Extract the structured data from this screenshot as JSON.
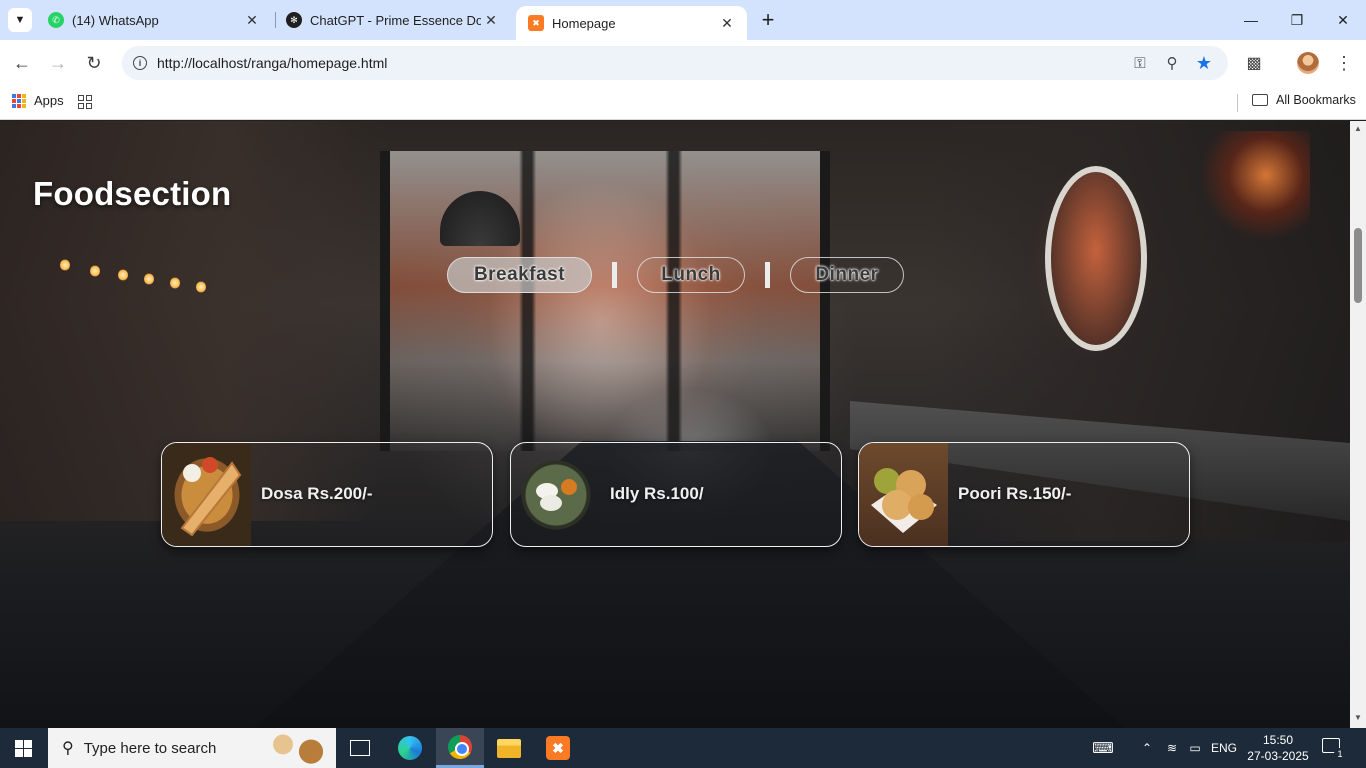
{
  "browser": {
    "tabs": [
      {
        "title": "(14) WhatsApp",
        "icon": "whatsapp-icon",
        "active": false
      },
      {
        "title": "ChatGPT - Prime Essence Doc",
        "icon": "chatgpt-icon",
        "active": false
      },
      {
        "title": "Homepage",
        "icon": "xampp-icon",
        "active": true
      }
    ],
    "url": "http://localhost/ranga/homepage.html",
    "bookmarks": {
      "apps_label": "Apps",
      "all_bookmarks_label": "All Bookmarks"
    }
  },
  "page": {
    "logo": "Foodsection",
    "menu": [
      {
        "label": "Breakfast",
        "active": true
      },
      {
        "label": "Lunch",
        "active": false
      },
      {
        "label": "Dinner",
        "active": false
      }
    ],
    "foods": [
      {
        "label": "Dosa Rs.200/-",
        "image": "dosa-image"
      },
      {
        "label": "Idly Rs.100/",
        "image": "idly-image"
      },
      {
        "label": "Poori Rs.150/-",
        "image": "poori-image"
      }
    ]
  },
  "taskbar": {
    "search_placeholder": "Type here to search",
    "language": "ENG",
    "time": "15:50",
    "date": "27-03-2025",
    "notification_count": "1"
  },
  "colors": {
    "tabstrip": "#d3e3fd",
    "taskbar": "#1d2a3a",
    "accent": "#1a73e8"
  }
}
